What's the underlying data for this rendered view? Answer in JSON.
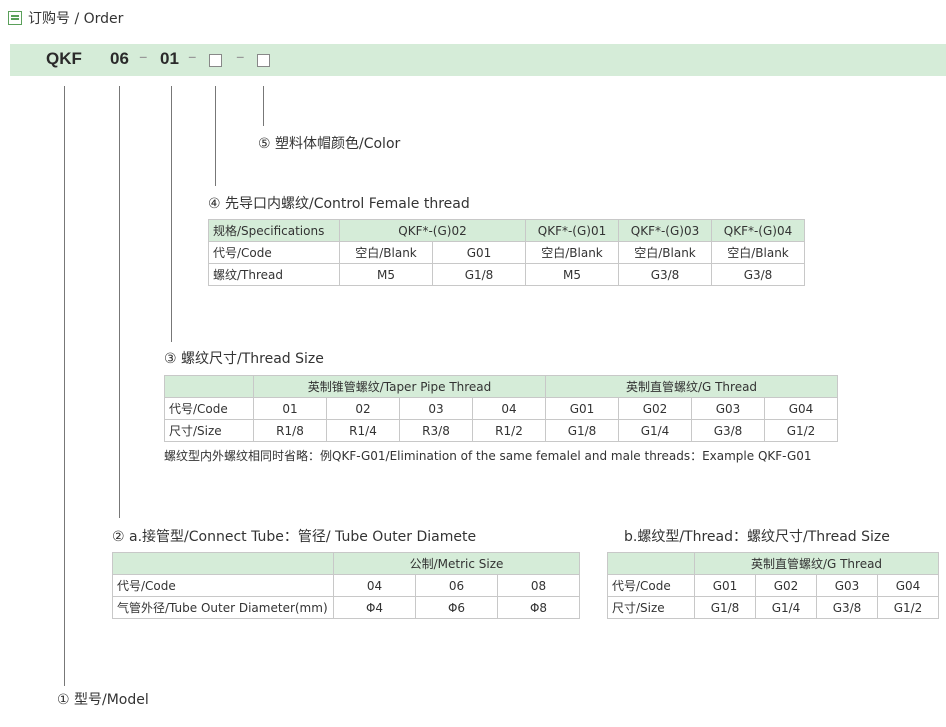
{
  "title": "订购号 / Order",
  "order_code": {
    "prefix": "QKF",
    "seg1": "06",
    "seg2": "01",
    "sep": "–"
  },
  "fields": {
    "color": "⑤ 塑料体帽颜色/Color",
    "control_thread": "④ 先导口内螺纹/Control Female thread",
    "thread_size": "③ 螺纹尺寸/Thread Size",
    "connect_tube": "② a.接管型/Connect Tube：管径/ Tube Outer Diamete",
    "thread_type": "b.螺纹型/Thread：螺纹尺寸/Thread Size",
    "model": "① 型号/Model"
  },
  "table4": {
    "header": [
      "规格/Specifications",
      "QKF*-(G)02",
      "QKF*-(G)01",
      "QKF*-(G)03",
      "QKF*-(G)04"
    ],
    "code_row": [
      "代号/Code",
      "空白/Blank",
      "G01",
      "空白/Blank",
      "空白/Blank",
      "空白/Blank"
    ],
    "thread_row": [
      "螺纹/Thread",
      "M5",
      "G1/8",
      "M5",
      "G3/8",
      "G3/8"
    ]
  },
  "table3": {
    "group_headers": [
      "英制锥管螺纹/Taper Pipe Thread",
      "英制直管螺纹/G Thread"
    ],
    "code_row": [
      "代号/Code",
      "01",
      "02",
      "03",
      "04",
      "G01",
      "G02",
      "G03",
      "G04"
    ],
    "size_row": [
      "尺寸/Size",
      "R1/8",
      "R1/4",
      "R3/8",
      "R1/2",
      "G1/8",
      "G1/4",
      "G3/8",
      "G1/2"
    ],
    "note": "螺纹型内外螺纹相同时省略：例QKF-G01/Elimination of the same femalel and male threads：Example QKF-G01"
  },
  "table2a": {
    "header": "公制/Metric Size",
    "code_row": [
      "代号/Code",
      "04",
      "06",
      "08"
    ],
    "dia_row": [
      "气管外径/Tube Outer Diameter(mm)",
      "Φ4",
      "Φ6",
      "Φ8"
    ]
  },
  "table2b": {
    "header": "英制直管螺纹/G Thread",
    "code_row": [
      "代号/Code",
      "G01",
      "G02",
      "G03",
      "G04"
    ],
    "size_row": [
      "尺寸/Size",
      "G1/8",
      "G1/4",
      "G3/8",
      "G1/2"
    ]
  },
  "colors": {
    "accent": "#d5ecd8",
    "icon": "#5aa05a"
  }
}
